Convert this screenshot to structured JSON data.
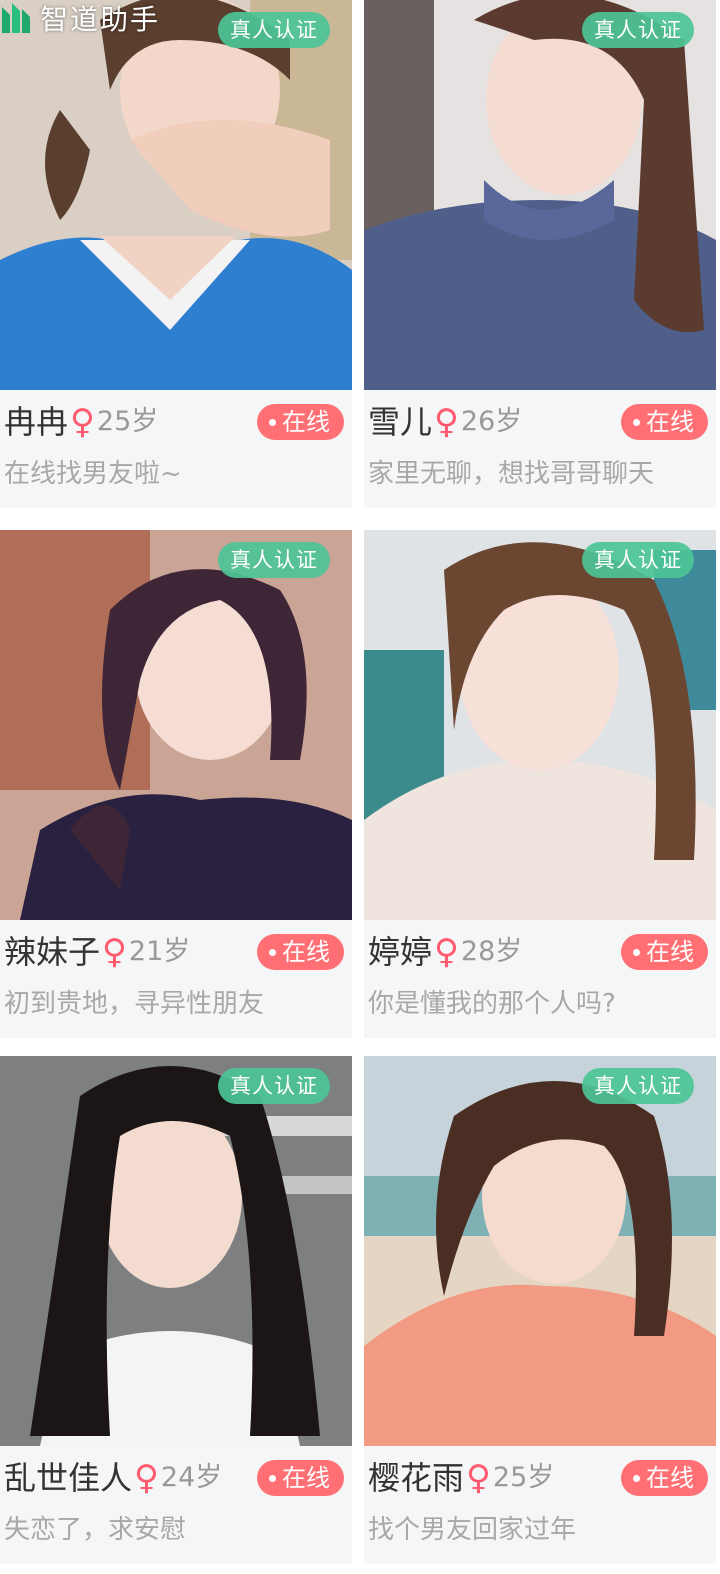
{
  "watermark": {
    "text": "智道助手",
    "logo_icon": "leaf-logo-icon"
  },
  "colors": {
    "online": "#ff6f73",
    "verify": "#4cc496",
    "gender": "#ff5a6e"
  },
  "profiles": [
    {
      "name": "冉冉",
      "gender_symbol": "♀",
      "age": "25岁",
      "verify_label": "真人认证",
      "status": "在线",
      "bio": "在线找男友啦~"
    },
    {
      "name": "雪儿",
      "gender_symbol": "♀",
      "age": "26岁",
      "verify_label": "真人认证",
      "status": "在线",
      "bio": "家里无聊，想找哥哥聊天"
    },
    {
      "name": "辣妹子",
      "gender_symbol": "♀",
      "age": "21岁",
      "verify_label": "真人认证",
      "status": "在线",
      "bio": "初到贵地，寻异性朋友"
    },
    {
      "name": "婷婷",
      "gender_symbol": "♀",
      "age": "28岁",
      "verify_label": "真人认证",
      "status": "在线",
      "bio": "你是懂我的那个人吗?"
    },
    {
      "name": "乱世佳人",
      "gender_symbol": "♀",
      "age": "24岁",
      "verify_label": "真人认证",
      "status": "在线",
      "bio": "失恋了，求安慰"
    },
    {
      "name": "樱花雨",
      "gender_symbol": "♀",
      "age": "25岁",
      "verify_label": "真人认证",
      "status": "在线",
      "bio": "找个男友回家过年"
    }
  ]
}
